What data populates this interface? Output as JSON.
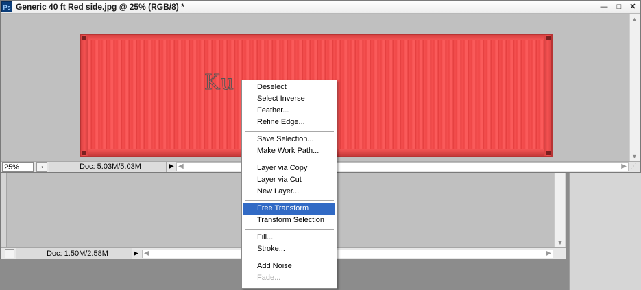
{
  "front_window": {
    "app_icon_text": "Ps",
    "title": "Generic 40 ft Red side.jpg @ 25% (RGB/8) *",
    "minimize_glyph": "—",
    "maximize_glyph": "□",
    "close_glyph": "✕",
    "selection_text": "Ku",
    "status": {
      "zoom": "25%",
      "doc": "Doc: 5.03M/5.03M"
    }
  },
  "back_window": {
    "status": {
      "doc": "Doc: 1.50M/2.58M"
    }
  },
  "context_menu": {
    "items": [
      {
        "label": "Deselect"
      },
      {
        "label": "Select Inverse"
      },
      {
        "label": "Feather..."
      },
      {
        "label": "Refine Edge..."
      },
      {
        "label": "Save Selection..."
      },
      {
        "label": "Make Work Path..."
      },
      {
        "label": "Layer via Copy"
      },
      {
        "label": "Layer via Cut"
      },
      {
        "label": "New Layer..."
      },
      {
        "label": "Free Transform",
        "state": "highlighted"
      },
      {
        "label": "Transform Selection"
      },
      {
        "label": "Fill..."
      },
      {
        "label": "Stroke..."
      },
      {
        "label": "Add Noise"
      },
      {
        "label": "Fade...",
        "state": "disabled"
      }
    ]
  },
  "colors": {
    "menu_highlight": "#316ac5",
    "container_red": "#f24848",
    "canvas_gray": "#c0c0c0"
  },
  "icons": [
    "photoshop-icon",
    "navigator-icon",
    "menu-triangle-icon",
    "scroll-arrow-icon"
  ]
}
